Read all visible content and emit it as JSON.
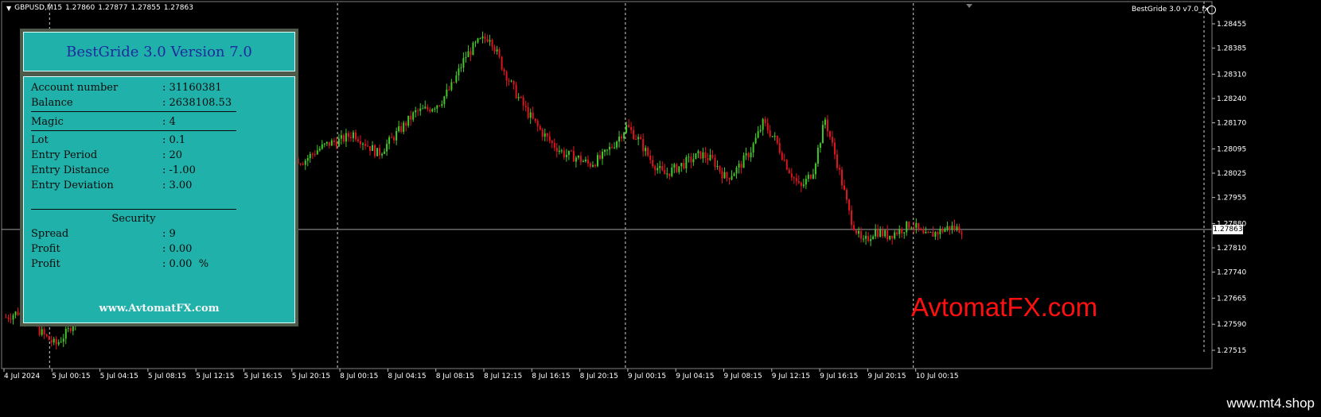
{
  "chart_header": {
    "symbol": "GBPUSD,M15",
    "open": "1.27860",
    "high": "1.27877",
    "low": "1.27855",
    "close": "1.27863",
    "menu_icon": "triangle-down-icon"
  },
  "ea_label": "BestGride 3.0 v7.0_fx",
  "ea_icon": "smiley-face-icon",
  "current_price": "1.27863",
  "colors": {
    "background": "#000000",
    "bull_candle": "#44c829",
    "bear_candle": "#e0141e",
    "panel_bg": "#20b2aa",
    "panel_title": "#1d2a9e",
    "watermark": "#ff1010"
  },
  "panel": {
    "title": "BestGride 3.0 Version 7.0",
    "rows": [
      {
        "label": "Account number",
        "value": ": 31160381"
      },
      {
        "label": "Balance",
        "value": ": 2638108.53"
      },
      {
        "label": "Magic",
        "value": ": 4"
      },
      {
        "label": "Lot",
        "value": ": 0.1"
      },
      {
        "label": "Entry Period",
        "value": ": 20"
      },
      {
        "label": "Entry Distance",
        "value": ": -1.00"
      },
      {
        "label": "Entry Deviation",
        "value": ": 3.00"
      },
      {
        "label": "Spread",
        "value": ": 9"
      },
      {
        "label": "Profit",
        "value": ": 0.00"
      },
      {
        "label": "Profit",
        "value": ": 0.00  %"
      }
    ],
    "security_title": "Security",
    "site_link": "www.AvtomatFX.com"
  },
  "watermark": "AvtomatFX.com",
  "footer_site": "www.mt4.shop",
  "chart_data": {
    "type": "candlestick",
    "y_ticks": [
      "1.28455",
      "1.28385",
      "1.28310",
      "1.28240",
      "1.28170",
      "1.28095",
      "1.28025",
      "1.27955",
      "1.27880",
      "1.27810",
      "1.27740",
      "1.27665",
      "1.27590",
      "1.27515"
    ],
    "ylim": [
      1.27515,
      1.28455
    ],
    "x_ticks": [
      "4 Jul 2024",
      "5 Jul 00:15",
      "5 Jul 04:15",
      "5 Jul 08:15",
      "5 Jul 12:15",
      "5 Jul 16:15",
      "5 Jul 20:15",
      "8 Jul 00:15",
      "8 Jul 04:15",
      "8 Jul 08:15",
      "8 Jul 12:15",
      "8 Jul 16:15",
      "8 Jul 20:15",
      "9 Jul 00:15",
      "9 Jul 04:15",
      "9 Jul 08:15",
      "9 Jul 12:15",
      "9 Jul 16:15",
      "9 Jul 20:15",
      "10 Jul 00:15"
    ],
    "period_separators": [
      "5 Jul 00:15",
      "8 Jul 00:15",
      "9 Jul 00:15",
      "10 Jul 00:15"
    ],
    "bid_line": 1.27863,
    "series_path": [
      [
        0,
        1.2761
      ],
      [
        2,
        1.27625
      ],
      [
        4,
        1.276
      ],
      [
        6,
        1.2756
      ],
      [
        8,
        1.2753
      ],
      [
        10,
        1.2757
      ],
      [
        12,
        1.2764
      ],
      [
        14,
        1.2772
      ],
      [
        16,
        1.2779
      ],
      [
        18,
        1.2786
      ],
      [
        20,
        1.279
      ],
      [
        22,
        1.2793
      ],
      [
        24,
        1.2797
      ],
      [
        26,
        1.28
      ],
      [
        28,
        1.2804
      ],
      [
        30,
        1.281
      ],
      [
        32,
        1.2815
      ],
      [
        34,
        1.2816
      ],
      [
        36,
        1.28145
      ],
      [
        38,
        1.2805
      ],
      [
        40,
        1.2788
      ],
      [
        42,
        1.2808
      ],
      [
        44,
        1.281
      ],
      [
        46,
        1.2807
      ],
      [
        48,
        1.2806
      ],
      [
        50,
        1.2809
      ],
      [
        52,
        1.2811
      ],
      [
        54,
        1.2812
      ],
      [
        56,
        1.2814
      ],
      [
        58,
        1.2811
      ],
      [
        60,
        1.2808
      ],
      [
        62,
        1.2812
      ],
      [
        64,
        1.2816
      ],
      [
        66,
        1.282
      ],
      [
        68,
        1.2821
      ],
      [
        70,
        1.2823
      ],
      [
        72,
        1.2828
      ],
      [
        74,
        1.2836
      ],
      [
        76,
        1.284
      ],
      [
        78,
        1.2842
      ],
      [
        80,
        1.2833
      ],
      [
        82,
        1.2826
      ],
      [
        84,
        1.282
      ],
      [
        86,
        1.2815
      ],
      [
        88,
        1.2811
      ],
      [
        90,
        1.2808
      ],
      [
        92,
        1.2807
      ],
      [
        94,
        1.2805
      ],
      [
        96,
        1.2807
      ],
      [
        98,
        1.2811
      ],
      [
        100,
        1.2816
      ],
      [
        102,
        1.2812
      ],
      [
        104,
        1.2806
      ],
      [
        106,
        1.2802
      ],
      [
        108,
        1.2804
      ],
      [
        110,
        1.2806
      ],
      [
        112,
        1.2808
      ],
      [
        114,
        1.2806
      ],
      [
        116,
        1.2801
      ],
      [
        118,
        1.2804
      ],
      [
        120,
        1.2809
      ],
      [
        122,
        1.2817
      ],
      [
        124,
        1.2812
      ],
      [
        126,
        1.2804
      ],
      [
        128,
        1.2798
      ],
      [
        130,
        1.2803
      ],
      [
        132,
        1.2818
      ],
      [
        134,
        1.2805
      ],
      [
        136,
        1.279
      ],
      [
        138,
        1.2782
      ],
      [
        140,
        1.2786
      ],
      [
        142,
        1.27845
      ],
      [
        144,
        1.2786
      ],
      [
        146,
        1.2788
      ],
      [
        148,
        1.2784
      ],
      [
        150,
        1.27855
      ],
      [
        152,
        1.2787
      ],
      [
        154,
        1.27863
      ]
    ]
  }
}
